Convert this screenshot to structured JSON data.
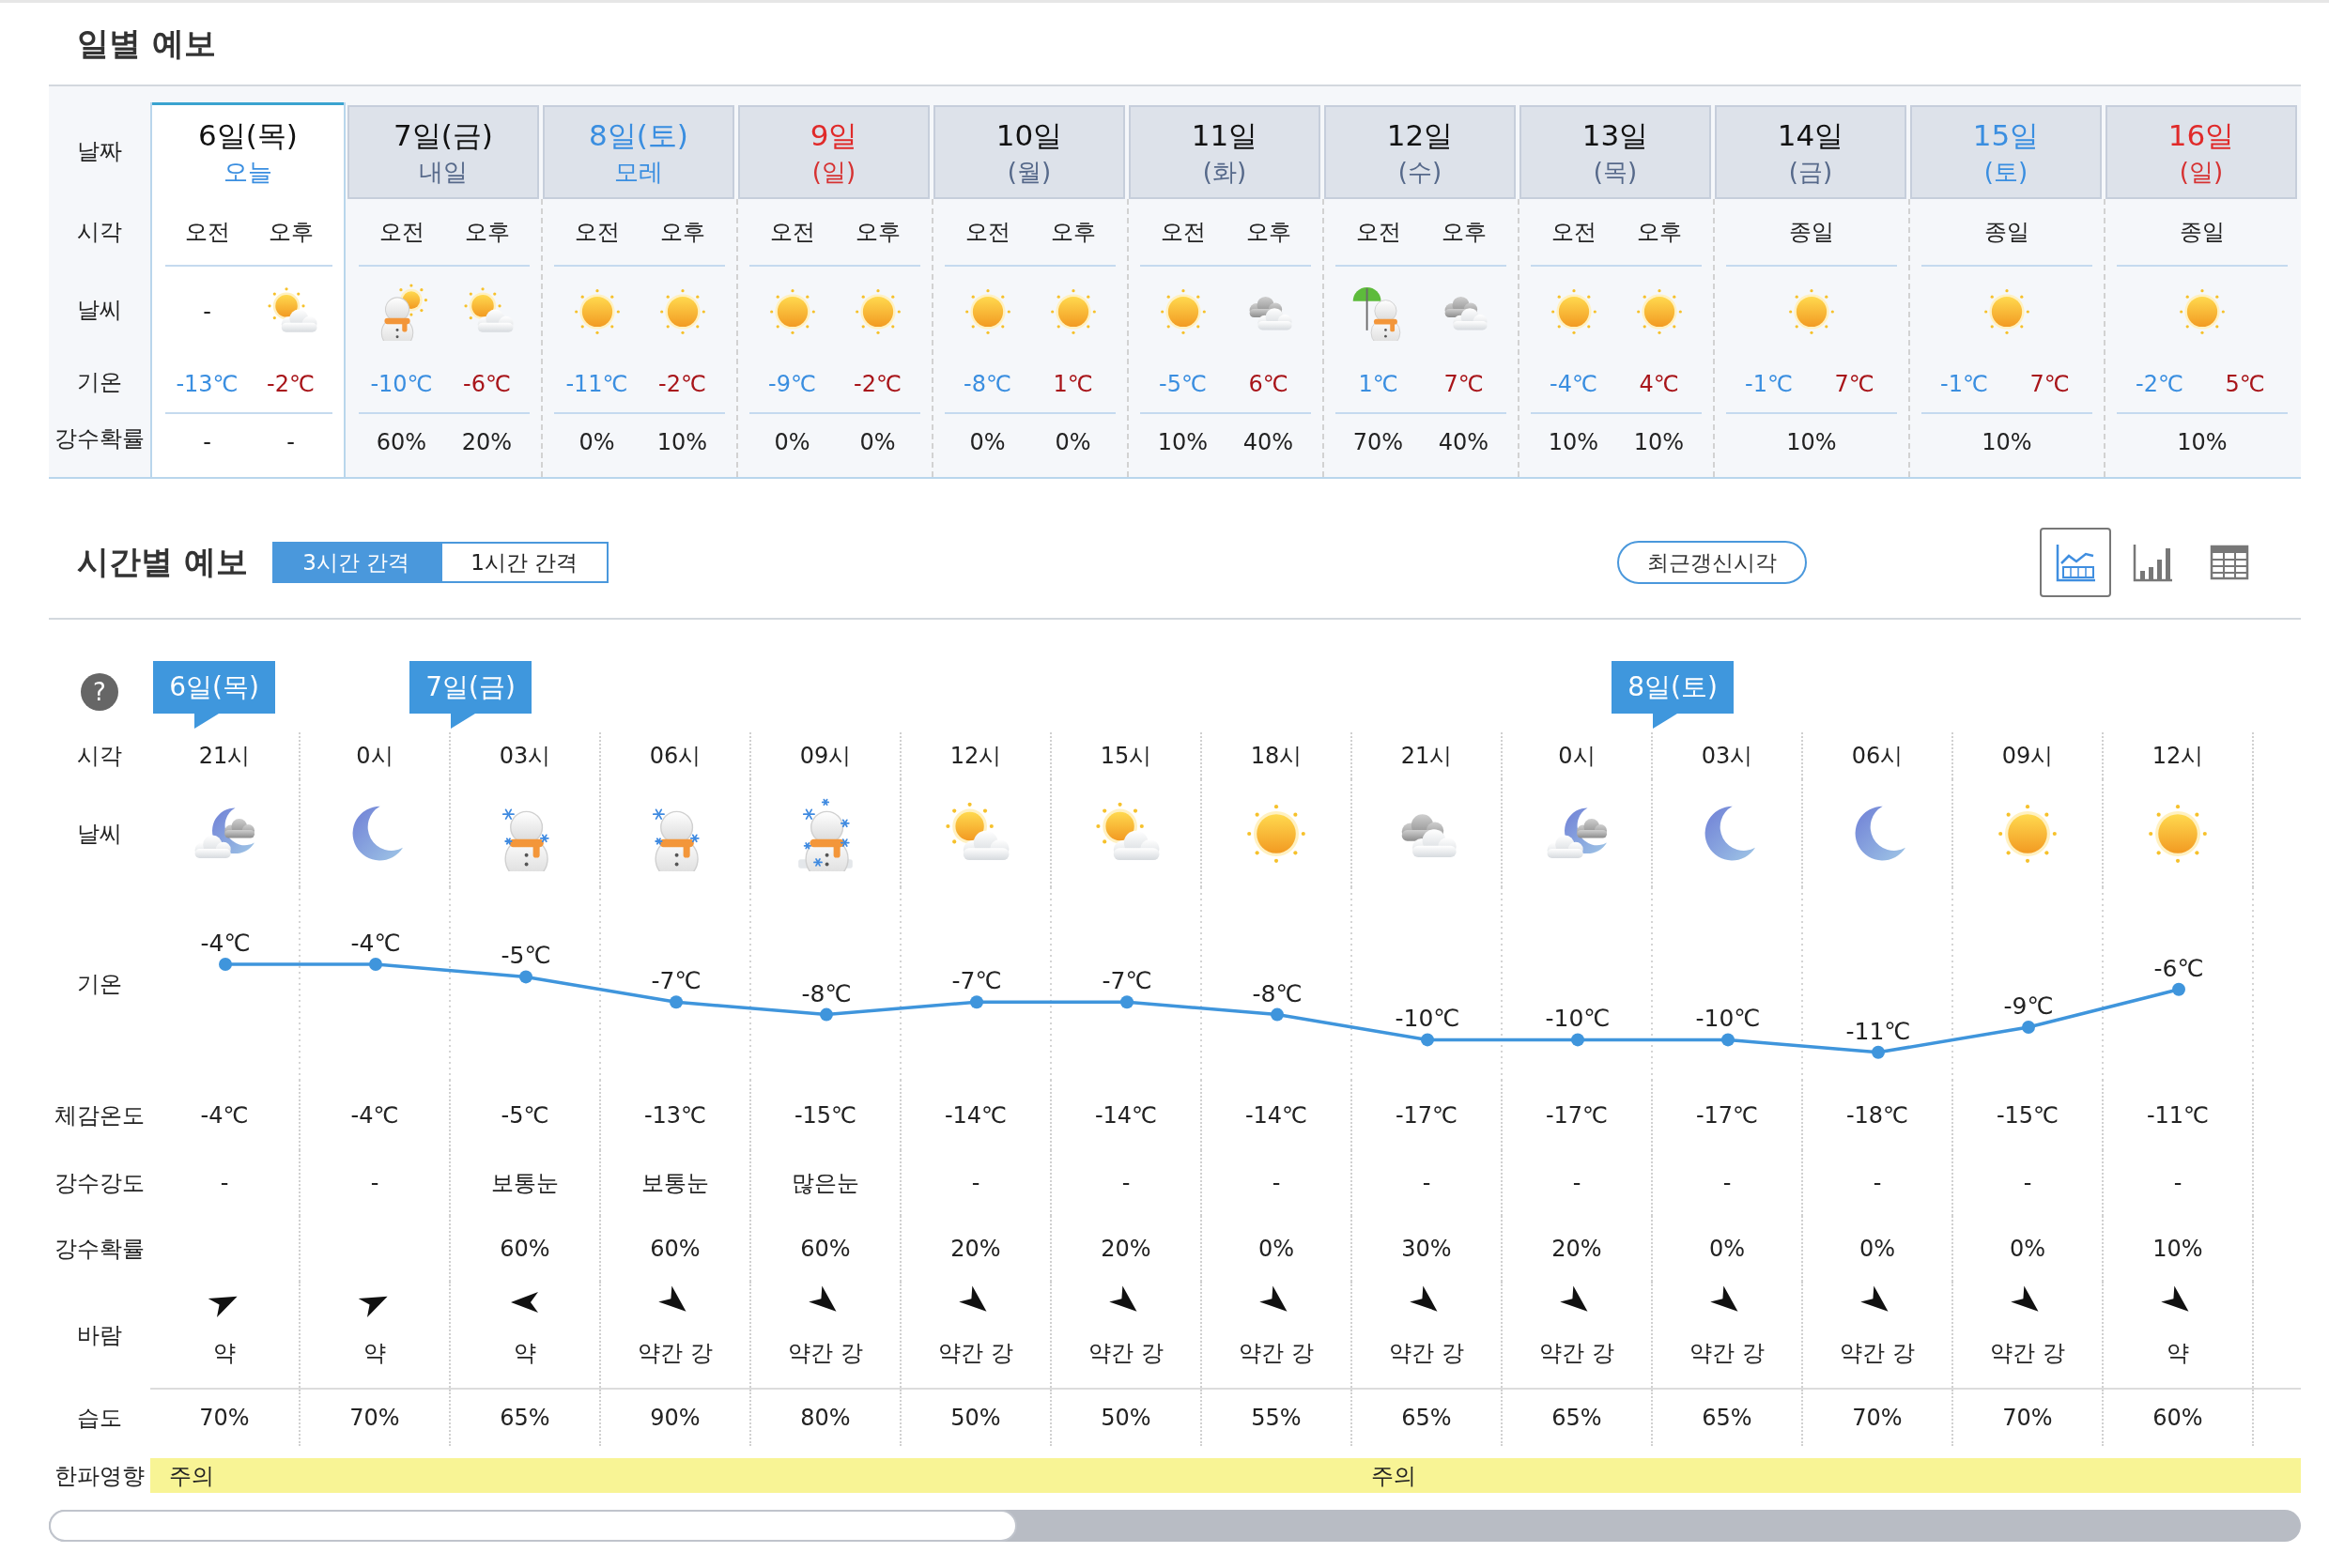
{
  "daily": {
    "title": "일별 예보",
    "row_labels": [
      "날짜",
      "시각",
      "날씨",
      "기온",
      "강수확률"
    ],
    "days": [
      {
        "date": "6일(목)",
        "sub": "오늘",
        "kind": "weekday",
        "selected": true,
        "periods": [
          "오전",
          "오후"
        ],
        "weather": [
          {
            "kind": "text",
            "text": "-"
          },
          {
            "kind": "sun-cloud"
          }
        ],
        "low": "-13℃",
        "high": "-2℃",
        "rain": [
          "-",
          "-"
        ]
      },
      {
        "date": "7일(금)",
        "sub": "내일",
        "kind": "weekday",
        "selected": false,
        "periods": [
          "오전",
          "오후"
        ],
        "weather": [
          {
            "kind": "snowman-sun"
          },
          {
            "kind": "sun-cloud"
          }
        ],
        "low": "-10℃",
        "high": "-6℃",
        "rain": [
          "60%",
          "20%"
        ]
      },
      {
        "date": "8일(토)",
        "sub": "모레",
        "kind": "saturday",
        "selected": false,
        "periods": [
          "오전",
          "오후"
        ],
        "weather": [
          {
            "kind": "sun"
          },
          {
            "kind": "sun"
          }
        ],
        "low": "-11℃",
        "high": "-2℃",
        "rain": [
          "0%",
          "10%"
        ]
      },
      {
        "date": "9일",
        "sub": "(일)",
        "kind": "sunday",
        "selected": false,
        "periods": [
          "오전",
          "오후"
        ],
        "weather": [
          {
            "kind": "sun"
          },
          {
            "kind": "sun"
          }
        ],
        "low": "-9℃",
        "high": "-2℃",
        "rain": [
          "0%",
          "0%"
        ]
      },
      {
        "date": "10일",
        "sub": "(월)",
        "kind": "weekday",
        "selected": false,
        "periods": [
          "오전",
          "오후"
        ],
        "weather": [
          {
            "kind": "sun"
          },
          {
            "kind": "sun"
          }
        ],
        "low": "-8℃",
        "high": "1℃",
        "rain": [
          "0%",
          "0%"
        ]
      },
      {
        "date": "11일",
        "sub": "(화)",
        "kind": "weekday",
        "selected": false,
        "periods": [
          "오전",
          "오후"
        ],
        "weather": [
          {
            "kind": "sun"
          },
          {
            "kind": "cloud"
          }
        ],
        "low": "-5℃",
        "high": "6℃",
        "rain": [
          "10%",
          "40%"
        ]
      },
      {
        "date": "12일",
        "sub": "(수)",
        "kind": "weekday",
        "selected": false,
        "periods": [
          "오전",
          "오후"
        ],
        "weather": [
          {
            "kind": "snowman-umbrella"
          },
          {
            "kind": "cloud"
          }
        ],
        "low": "1℃",
        "high": "7℃",
        "rain": [
          "70%",
          "40%"
        ]
      },
      {
        "date": "13일",
        "sub": "(목)",
        "kind": "weekday",
        "selected": false,
        "periods": [
          "오전",
          "오후"
        ],
        "weather": [
          {
            "kind": "sun"
          },
          {
            "kind": "sun"
          }
        ],
        "low": "-4℃",
        "high": "4℃",
        "rain": [
          "10%",
          "10%"
        ]
      },
      {
        "date": "14일",
        "sub": "(금)",
        "kind": "weekday",
        "selected": false,
        "periods": [
          "종일"
        ],
        "weather": [
          {
            "kind": "sun"
          }
        ],
        "low": "-1℃",
        "high": "7℃",
        "rain": [
          "10%"
        ]
      },
      {
        "date": "15일",
        "sub": "(토)",
        "kind": "saturday",
        "selected": false,
        "periods": [
          "종일"
        ],
        "weather": [
          {
            "kind": "sun"
          }
        ],
        "low": "-1℃",
        "high": "7℃",
        "rain": [
          "10%"
        ]
      },
      {
        "date": "16일",
        "sub": "(일)",
        "kind": "sunday",
        "selected": false,
        "periods": [
          "종일"
        ],
        "weather": [
          {
            "kind": "sun"
          }
        ],
        "low": "-2℃",
        "high": "5℃",
        "rain": [
          "10%"
        ]
      }
    ]
  },
  "hourly": {
    "title": "시간별 예보",
    "intervals": [
      {
        "label": "3시간 간격",
        "selected": true
      },
      {
        "label": "1시간 간격",
        "selected": false
      }
    ],
    "refresh_button": "최근갱신시각",
    "views": [
      {
        "kind": "line",
        "selected": true
      },
      {
        "kind": "bar",
        "selected": false
      },
      {
        "kind": "table",
        "selected": false
      }
    ],
    "help": "?",
    "row_labels": [
      "시각",
      "날씨",
      "기온",
      "체감온도",
      "강수강도",
      "강수확률",
      "바람",
      "습도",
      "한파영향"
    ],
    "hours": [
      {
        "time": "21시",
        "weather": {
          "kind": "moon-cloud"
        },
        "feels": "-4℃",
        "intensity": "-",
        "wind": {
          "kind": "ENE",
          "text": "약"
        },
        "humidity": "70%",
        "flag": "6일(목)",
        "cold_wave": "주의"
      },
      {
        "time": "0시",
        "weather": {
          "kind": "moon"
        },
        "feels": "-4℃",
        "intensity": "-",
        "wind": {
          "kind": "ENE",
          "text": "약"
        },
        "humidity": "70%",
        "flag": "7일(금)"
      },
      {
        "time": "03시",
        "weather": {
          "kind": "snowman"
        },
        "feels": "-5℃",
        "intensity": "보통눈",
        "rain": "60%",
        "wind": {
          "kind": "W",
          "text": "약"
        },
        "humidity": "65%"
      },
      {
        "time": "06시",
        "weather": {
          "kind": "snowman"
        },
        "feels": "-13℃",
        "intensity": "보통눈",
        "rain": "60%",
        "wind": {
          "kind": "SE",
          "text": "약간 강"
        },
        "humidity": "90%"
      },
      {
        "time": "09시",
        "weather": {
          "kind": "snowman-heavy"
        },
        "feels": "-15℃",
        "intensity": "많은눈",
        "rain": "60%",
        "wind": {
          "kind": "SE",
          "text": "약간 강"
        },
        "humidity": "80%"
      },
      {
        "time": "12시",
        "weather": {
          "kind": "sun-cloud"
        },
        "feels": "-14℃",
        "intensity": "-",
        "rain": "20%",
        "wind": {
          "kind": "SE",
          "text": "약간 강"
        },
        "humidity": "50%"
      },
      {
        "time": "15시",
        "weather": {
          "kind": "sun-cloud"
        },
        "feels": "-14℃",
        "intensity": "-",
        "rain": "20%",
        "wind": {
          "kind": "SE",
          "text": "약간 강"
        },
        "humidity": "50%"
      },
      {
        "time": "18시",
        "weather": {
          "kind": "sun"
        },
        "feels": "-14℃",
        "intensity": "-",
        "rain": "0%",
        "wind": {
          "kind": "SE",
          "text": "약간 강"
        },
        "humidity": "55%"
      },
      {
        "time": "21시",
        "weather": {
          "kind": "cloud"
        },
        "feels": "-17℃",
        "intensity": "-",
        "rain": "30%",
        "wind": {
          "kind": "SE",
          "text": "약간 강"
        },
        "humidity": "65%",
        "cold_wave": "주의"
      },
      {
        "time": "0시",
        "weather": {
          "kind": "moon-cloud"
        },
        "feels": "-17℃",
        "intensity": "-",
        "rain": "20%",
        "wind": {
          "kind": "SE",
          "text": "약간 강"
        },
        "humidity": "65%",
        "flag": "8일(토)"
      },
      {
        "time": "03시",
        "weather": {
          "kind": "moon"
        },
        "feels": "-17℃",
        "intensity": "-",
        "rain": "0%",
        "wind": {
          "kind": "SE",
          "text": "약간 강"
        },
        "humidity": "65%"
      },
      {
        "time": "06시",
        "weather": {
          "kind": "moon"
        },
        "feels": "-18℃",
        "intensity": "-",
        "rain": "0%",
        "wind": {
          "kind": "SE",
          "text": "약간 강"
        },
        "humidity": "70%"
      },
      {
        "time": "09시",
        "weather": {
          "kind": "sun"
        },
        "feels": "-15℃",
        "intensity": "-",
        "rain": "0%",
        "wind": {
          "kind": "SE",
          "text": "약간 강"
        },
        "humidity": "70%"
      },
      {
        "time": "12시",
        "weather": {
          "kind": "sun"
        },
        "feels": "-11℃",
        "intensity": "-",
        "rain": "10%",
        "wind": {
          "kind": "SE",
          "text": "약"
        },
        "humidity": "60%"
      }
    ],
    "temperature": {
      "chart_data": {
        "type": "line",
        "categories": [
          null,
          null,
          null,
          null,
          null,
          null,
          null,
          null,
          null,
          null,
          null,
          null,
          null,
          null
        ],
        "series": [
          {
            "color": "#3f95dc",
            "marker": "circle",
            "values": [
              -4,
              -4,
              -5,
              -7,
              -8,
              -7,
              -7,
              -8,
              -10,
              -10,
              -10,
              -11,
              -9,
              -6
            ],
            "value_labels": [
              "-4℃",
              "-4℃",
              "-5℃",
              "-7℃",
              "-8℃",
              "-7℃",
              "-7℃",
              "-8℃",
              "-10℃",
              "-10℃",
              "-10℃",
              "-11℃",
              "-9℃",
              "-6℃"
            ]
          }
        ]
      }
    }
  }
}
